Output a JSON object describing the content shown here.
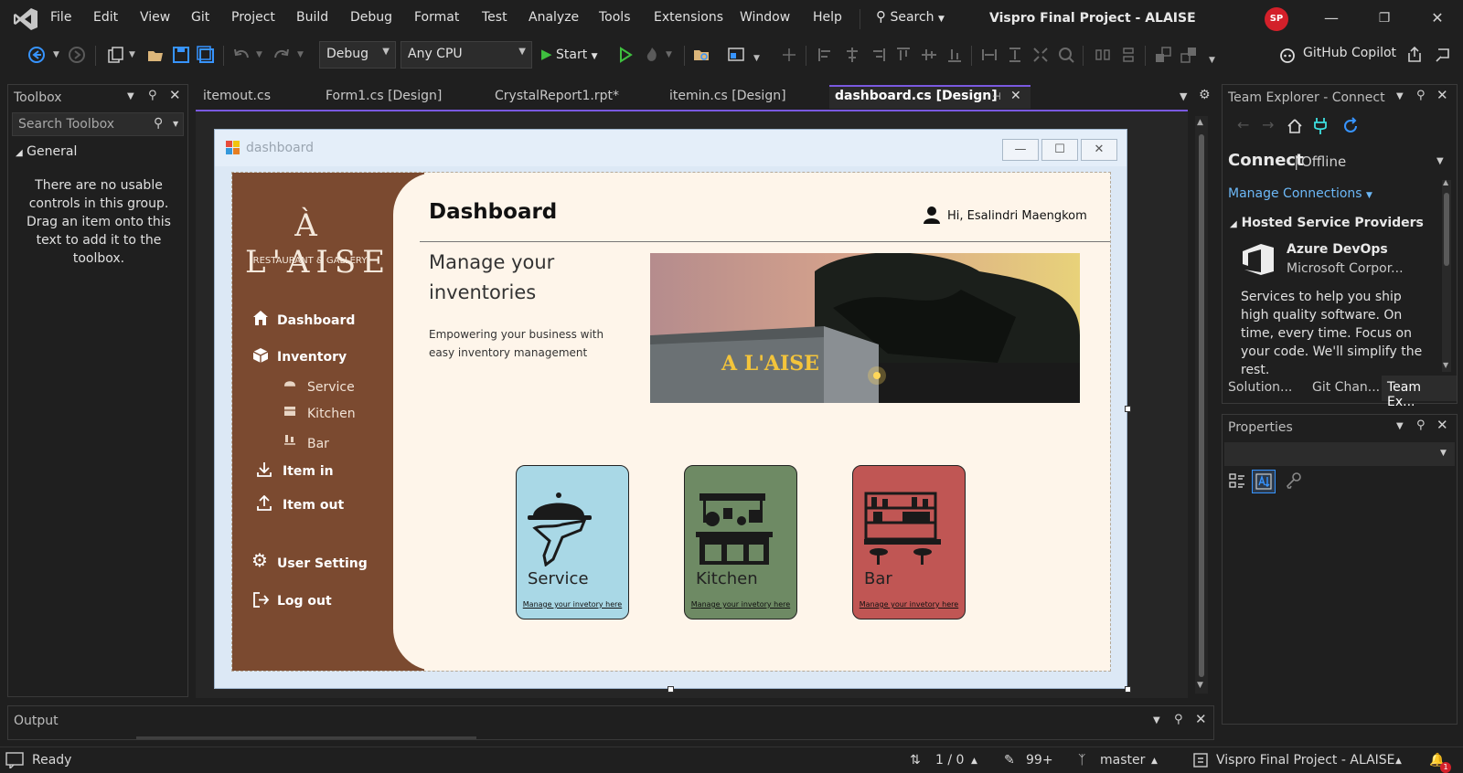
{
  "titlebar": {
    "menu": [
      "File",
      "Edit",
      "View",
      "Git",
      "Project",
      "Build",
      "Debug",
      "Format",
      "Test",
      "Analyze",
      "Tools",
      "Extensions",
      "Window",
      "Help"
    ],
    "search_label": "Search",
    "window_title": "Vispro Final Project - ALAISE",
    "user_initials": "SP"
  },
  "toolbar": {
    "config": "Debug",
    "platform": "Any CPU",
    "start_label": "Start",
    "copilot_label": "GitHub Copilot"
  },
  "toolbox": {
    "title": "Toolbox",
    "search_placeholder": "Search Toolbox",
    "group": "General",
    "empty_text": "There are no usable controls in this group. Drag an item onto this text to add it to the toolbox."
  },
  "tabs": [
    {
      "label": "itemout.cs"
    },
    {
      "label": "Form1.cs [Design]"
    },
    {
      "label": "CrystalReport1.rpt*"
    },
    {
      "label": "itemin.cs [Design]"
    },
    {
      "label": "dashboard.cs [Design]"
    }
  ],
  "form": {
    "title": "dashboard",
    "brand": "À L'AISE",
    "brand_sub": "RESTAURANT & GALLERY",
    "nav": {
      "dashboard": "Dashboard",
      "inventory": "Inventory",
      "service": "Service",
      "kitchen": "Kitchen",
      "bar": "Bar",
      "item_in": "Item in",
      "item_out": "Item out",
      "user_setting": "User Setting",
      "log_out": "Log out"
    },
    "page_title": "Dashboard",
    "greeting": "Hi, Esalindri Maengkom",
    "headline": "Manage your inventories",
    "tagline": "Empowering your business with easy inventory management",
    "hero_sign": "A L'AISE",
    "cards": [
      {
        "label": "Service",
        "link": "Manage your invetory here",
        "color": "#a9d8e6"
      },
      {
        "label": "Kitchen",
        "link": "Manage your invetory here",
        "color": "#6e8a64"
      },
      {
        "label": "Bar",
        "link": "Manage your invetory here",
        "color": "#c05654"
      }
    ]
  },
  "team_explorer": {
    "title": "Team Explorer - Connect",
    "connect": "Connect",
    "status": "Offline",
    "manage": "Manage Connections",
    "providers_header": "Hosted Service Providers",
    "provider_name": "Azure DevOps",
    "provider_corp": "Microsoft Corpor...",
    "provider_desc": "Services to help you ship high quality software. On time, every time. Focus on your code. We'll simplify the rest.",
    "tabs": [
      "Solution...",
      "Git Chan...",
      "Team Ex..."
    ]
  },
  "properties": {
    "title": "Properties"
  },
  "output": {
    "title": "Output"
  },
  "statusbar": {
    "ready": "Ready",
    "lines": "1 / 0",
    "edits": "99+",
    "branch": "master",
    "repo": "Vispro Final Project - ALAISE",
    "notif_count": "1"
  },
  "colors": {
    "accent": "#7a59e0",
    "sidebar": "#7b4a30",
    "content_bg": "#fef5ea"
  }
}
